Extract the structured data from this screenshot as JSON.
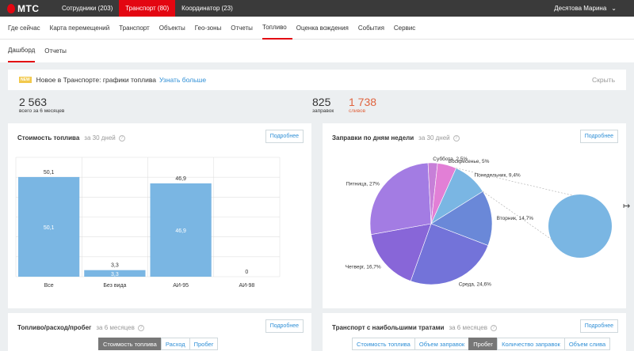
{
  "header": {
    "logo": "МТС",
    "tabs": [
      {
        "label": "Сотрудники (203)",
        "active": false
      },
      {
        "label": "Транспорт (80)",
        "active": true
      },
      {
        "label": "Координатор (23)",
        "active": false
      }
    ],
    "user": "Десятова Марина"
  },
  "nav": {
    "items": [
      "Где сейчас",
      "Карта перемещений",
      "Транспорт",
      "Объекты",
      "Гео-зоны",
      "Отчеты",
      "Топливо",
      "Оценка вождения",
      "События",
      "Сервис"
    ],
    "active": "Топливо"
  },
  "subnav": {
    "items": [
      "Дашборд",
      "Отчеты"
    ],
    "active": "Дашборд"
  },
  "banner": {
    "badge": "NEW",
    "text": "Новое в Транспорте: графики топлива",
    "link": "Узнать больше",
    "close": "Скрыть"
  },
  "stats": {
    "total_value": "2 563",
    "total_label": "всего за 6 месяцев",
    "refuels_value": "825",
    "refuels_label": "заправок",
    "drains_value": "1 738",
    "drains_label": "сливов"
  },
  "cost_card": {
    "title": "Стоимость топлива",
    "period": "за 30 дней",
    "more": "Подробнее"
  },
  "pie_card": {
    "title": "Заправки по дням недели",
    "period": "за 30 дней",
    "more": "Подробнее"
  },
  "consumption_card": {
    "title": "Топливо/расход/пробег",
    "period": "за 6 месяцев",
    "more": "Подробнее",
    "segments": [
      "Стоимость топлива",
      "Расход",
      "Пробег"
    ],
    "active_segment": "Стоимость топлива"
  },
  "top_card": {
    "title": "Транспорт с наибольшими тратами",
    "period": "за 6 месяцев",
    "more": "Подробнее",
    "segments": [
      "Стоимость топлива",
      "Объем заправок",
      "Пробег",
      "Количество заправок",
      "Объем слива"
    ],
    "active_segment": "Пробег"
  },
  "chart_data": [
    {
      "type": "bar",
      "categories": [
        "Все",
        "Без вида",
        "АИ-95",
        "АИ-98"
      ],
      "values": [
        50.1,
        3.3,
        46.9,
        0
      ],
      "value_labels": [
        "50,1",
        "3,3",
        "46,9",
        "0"
      ],
      "ylim": [
        0,
        60
      ],
      "grid": true,
      "colors": {
        "bar": "#7ab6e3",
        "grid": "#e0e0e0"
      }
    },
    {
      "type": "pie",
      "labels": [
        "Понедельник",
        "Вторник",
        "Среда",
        "Четверг",
        "Пятница",
        "Суббота",
        "Воскресенье"
      ],
      "values": [
        9.4,
        14.7,
        24.6,
        16.7,
        27,
        2.5,
        5
      ],
      "display_labels": [
        "Понедельник, 9,4%",
        "Вторник, 14,7%",
        "Среда, 24,6%",
        "Четверг, 16,7%",
        "Пятница, 27%",
        "Суббота, 2,5%",
        "Воскресенье, 5%"
      ],
      "colors": [
        "#7ab6e3",
        "#6a88d8",
        "#7373d9",
        "#8866d8",
        "#a37ce3",
        "#c77fd8",
        "#e27fd6"
      ],
      "drilldown": "Понедельник"
    }
  ]
}
